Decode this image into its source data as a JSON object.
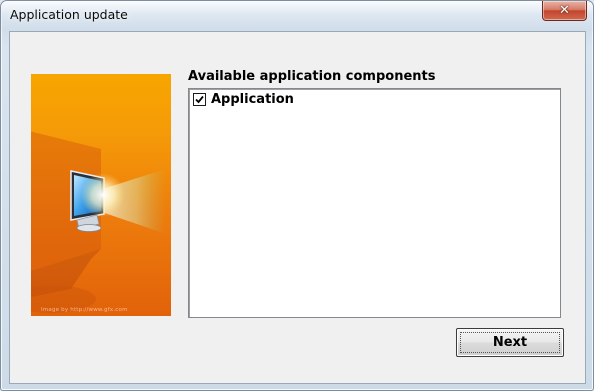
{
  "window": {
    "title": "Application update",
    "close_icon": "close-icon"
  },
  "banner": {
    "icon": "monitor-icon",
    "watermark": "Image by http://www.gfx.com",
    "colors": {
      "top": "#f7a600",
      "bottom": "#e2620a"
    }
  },
  "components": {
    "label": "Available application components",
    "items": [
      {
        "label": "Application",
        "checked": true
      }
    ]
  },
  "buttons": {
    "next_label": "Next"
  }
}
